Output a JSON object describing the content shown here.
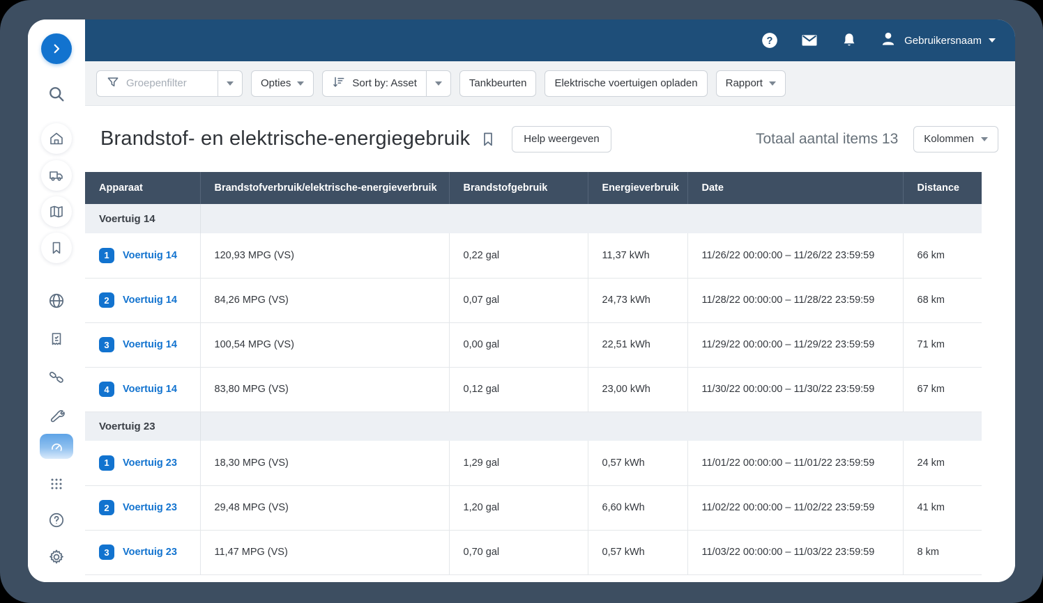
{
  "topbar": {
    "user_name": "Gebruikersnaam"
  },
  "toolbar": {
    "group_filter_placeholder": "Groepenfilter",
    "options_label": "Opties",
    "sort_label": "Sort by: Asset",
    "fuel_ups_label": "Tankbeurten",
    "ev_charging_label": "Elektrische voertuigen opladen",
    "report_label": "Rapport"
  },
  "page": {
    "title": "Brandstof- en elektrische-energiegebruik",
    "help_button": "Help weergeven",
    "total_items": "Totaal aantal items 13",
    "columns_button": "Kolommen"
  },
  "table": {
    "headers": [
      "Apparaat",
      "Brandstofverbruik/elektrische-energieverbruik",
      "Brandstofgebruik",
      "Energieverbruik",
      "Date",
      "Distance"
    ],
    "groups": [
      {
        "label": "Voertuig 14",
        "rows": [
          {
            "index": "1",
            "asset": "Voertuig 14",
            "consumption": "120,93 MPG (VS)",
            "fuel": "0,22 gal",
            "energy": "11,37 kWh",
            "date": "11/26/22 00:00:00 – 11/26/22 23:59:59",
            "distance": "66 km"
          },
          {
            "index": "2",
            "asset": "Voertuig 14",
            "consumption": "84,26 MPG (VS)",
            "fuel": "0,07 gal",
            "energy": "24,73 kWh",
            "date": "11/28/22 00:00:00 – 11/28/22 23:59:59",
            "distance": "68 km"
          },
          {
            "index": "3",
            "asset": "Voertuig 14",
            "consumption": "100,54 MPG (VS)",
            "fuel": "0,00 gal",
            "energy": "22,51 kWh",
            "date": "11/29/22 00:00:00 – 11/29/22 23:59:59",
            "distance": "71 km"
          },
          {
            "index": "4",
            "asset": "Voertuig 14",
            "consumption": "83,80 MPG (VS)",
            "fuel": "0,12 gal",
            "energy": "23,00 kWh",
            "date": "11/30/22 00:00:00 – 11/30/22 23:59:59",
            "distance": "67 km"
          }
        ]
      },
      {
        "label": "Voertuig 23",
        "rows": [
          {
            "index": "1",
            "asset": "Voertuig 23",
            "consumption": "18,30 MPG (VS)",
            "fuel": "1,29 gal",
            "energy": "0,57 kWh",
            "date": "11/01/22 00:00:00 – 11/01/22 23:59:59",
            "distance": "24 km"
          },
          {
            "index": "2",
            "asset": "Voertuig 23",
            "consumption": "29,48 MPG (VS)",
            "fuel": "1,20 gal",
            "energy": "6,60 kWh",
            "date": "11/02/22 00:00:00 – 11/02/22 23:59:59",
            "distance": "41 km"
          },
          {
            "index": "3",
            "asset": "Voertuig 23",
            "consumption": "11,47 MPG (VS)",
            "fuel": "0,70 gal",
            "energy": "0,57 kWh",
            "date": "11/03/22 00:00:00 – 11/03/22 23:59:59",
            "distance": "8 km"
          }
        ]
      }
    ]
  },
  "colors": {
    "frame": "#3d4e61",
    "topbar": "#1e4e79",
    "table_header": "#3e4f63",
    "group_row": "#edf0f4",
    "accent_blue": "#1273cf",
    "toolbar_bg": "#f0f2f4"
  }
}
